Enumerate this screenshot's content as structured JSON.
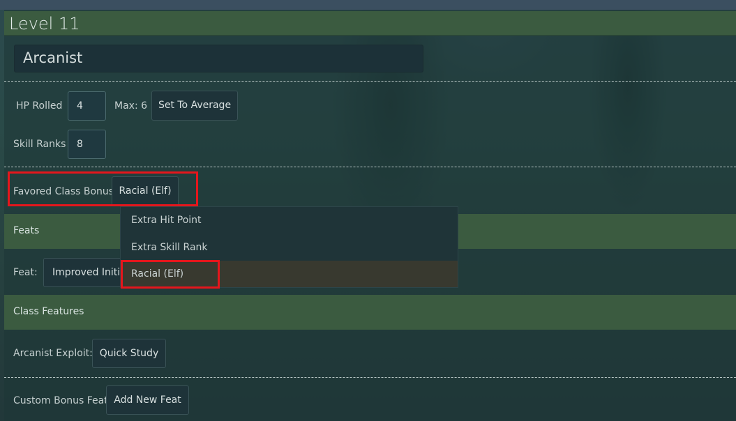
{
  "level": {
    "title": "Level 11"
  },
  "class": {
    "name": "Arcanist"
  },
  "hp": {
    "label": "HP Rolled",
    "value": "4",
    "max_label": "Max: 6",
    "average_button": "Set To Average"
  },
  "skills": {
    "label": "Skill Ranks",
    "value": "8"
  },
  "favored": {
    "label": "Favored Class Bonus",
    "selected": "Racial (Elf)",
    "options": [
      "Extra Hit Point",
      "Extra Skill Rank",
      "Racial (Elf)"
    ]
  },
  "feats": {
    "title": "Feats",
    "feat_label": "Feat:",
    "feat_value": "Improved Initiative"
  },
  "class_features": {
    "title": "Class Features",
    "exploit_label": "Arcanist Exploit:",
    "exploit_value": "Quick Study"
  },
  "custom_bonus": {
    "label": "Custom Bonus Feat",
    "add_button": "Add New Feat"
  },
  "colors": {
    "header_green": "#3b5b40",
    "highlight_red": "#e5161c",
    "selected_option": "#38392f"
  }
}
